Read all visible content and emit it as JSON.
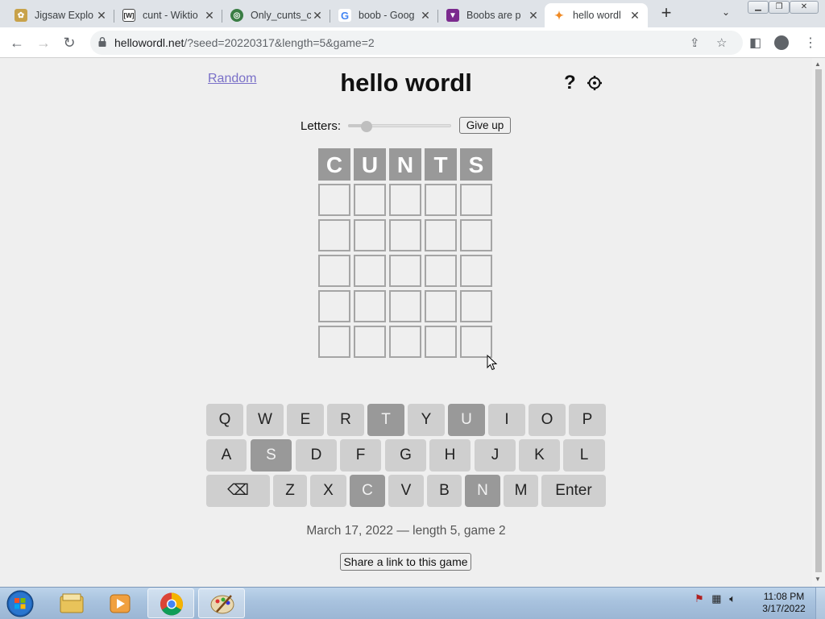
{
  "tabs": [
    {
      "title": "Jigsaw Explo",
      "favicon": "jigsaw-icon"
    },
    {
      "title": "cunt - Wiktio",
      "favicon": "wiktionary-icon"
    },
    {
      "title": "Only_cunts_c",
      "favicon": "wikimedia-icon"
    },
    {
      "title": "boob - Goog",
      "favicon": "google-icon"
    },
    {
      "title": "Boobs are p",
      "favicon": "tumblr-icon"
    },
    {
      "title": "hello wordl",
      "favicon": "wordl-icon"
    }
  ],
  "address_bar": {
    "host": "hellowordl.net",
    "path": "/?seed=20220317&length=5&game=2"
  },
  "game": {
    "random_link": "Random",
    "title": "hello wordl",
    "help": "?",
    "letters_label": "Letters:",
    "letters_slider_value": 5,
    "letters_slider_min": 4,
    "letters_slider_max": 11,
    "give_up": "Give up",
    "board": [
      [
        {
          "letter": "C",
          "state": "absent"
        },
        {
          "letter": "U",
          "state": "absent"
        },
        {
          "letter": "N",
          "state": "absent"
        },
        {
          "letter": "T",
          "state": "absent"
        },
        {
          "letter": "S",
          "state": "absent"
        }
      ],
      [
        {
          "letter": "",
          "state": "empty"
        },
        {
          "letter": "",
          "state": "empty"
        },
        {
          "letter": "",
          "state": "empty"
        },
        {
          "letter": "",
          "state": "empty"
        },
        {
          "letter": "",
          "state": "empty"
        }
      ],
      [
        {
          "letter": "",
          "state": "empty"
        },
        {
          "letter": "",
          "state": "empty"
        },
        {
          "letter": "",
          "state": "empty"
        },
        {
          "letter": "",
          "state": "empty"
        },
        {
          "letter": "",
          "state": "empty"
        }
      ],
      [
        {
          "letter": "",
          "state": "empty"
        },
        {
          "letter": "",
          "state": "empty"
        },
        {
          "letter": "",
          "state": "empty"
        },
        {
          "letter": "",
          "state": "empty"
        },
        {
          "letter": "",
          "state": "empty"
        }
      ],
      [
        {
          "letter": "",
          "state": "empty"
        },
        {
          "letter": "",
          "state": "empty"
        },
        {
          "letter": "",
          "state": "empty"
        },
        {
          "letter": "",
          "state": "empty"
        },
        {
          "letter": "",
          "state": "empty"
        }
      ],
      [
        {
          "letter": "",
          "state": "empty"
        },
        {
          "letter": "",
          "state": "empty"
        },
        {
          "letter": "",
          "state": "empty"
        },
        {
          "letter": "",
          "state": "empty"
        },
        {
          "letter": "",
          "state": "empty"
        }
      ]
    ],
    "keyboard": [
      [
        {
          "label": "Q",
          "state": "unused"
        },
        {
          "label": "W",
          "state": "unused"
        },
        {
          "label": "E",
          "state": "unused"
        },
        {
          "label": "R",
          "state": "unused"
        },
        {
          "label": "T",
          "state": "absent"
        },
        {
          "label": "Y",
          "state": "unused"
        },
        {
          "label": "U",
          "state": "absent"
        },
        {
          "label": "I",
          "state": "unused"
        },
        {
          "label": "O",
          "state": "unused"
        },
        {
          "label": "P",
          "state": "unused"
        }
      ],
      [
        {
          "label": "A",
          "state": "unused"
        },
        {
          "label": "S",
          "state": "absent"
        },
        {
          "label": "D",
          "state": "unused"
        },
        {
          "label": "F",
          "state": "unused"
        },
        {
          "label": "G",
          "state": "unused"
        },
        {
          "label": "H",
          "state": "unused"
        },
        {
          "label": "J",
          "state": "unused"
        },
        {
          "label": "K",
          "state": "unused"
        },
        {
          "label": "L",
          "state": "unused"
        }
      ],
      [
        {
          "label": "⌫",
          "state": "unused"
        },
        {
          "label": "Z",
          "state": "unused"
        },
        {
          "label": "X",
          "state": "unused"
        },
        {
          "label": "C",
          "state": "absent"
        },
        {
          "label": "V",
          "state": "unused"
        },
        {
          "label": "B",
          "state": "unused"
        },
        {
          "label": "N",
          "state": "absent"
        },
        {
          "label": "M",
          "state": "unused"
        },
        {
          "label": "Enter",
          "state": "unused"
        }
      ]
    ],
    "date_line": "March 17, 2022 — length 5, game 2",
    "share_button": "Share a link to this game"
  },
  "taskbar": {
    "apps": [
      "windows-explorer-icon",
      "media-player-icon",
      "chrome-icon",
      "paint-icon"
    ],
    "clock_time": "11:08 PM",
    "clock_date": "3/17/2022"
  },
  "colors": {
    "absent_tile": "#999999",
    "key_default": "#cfcfcf",
    "link": "#7a70c8",
    "page_bg": "#efefef"
  }
}
